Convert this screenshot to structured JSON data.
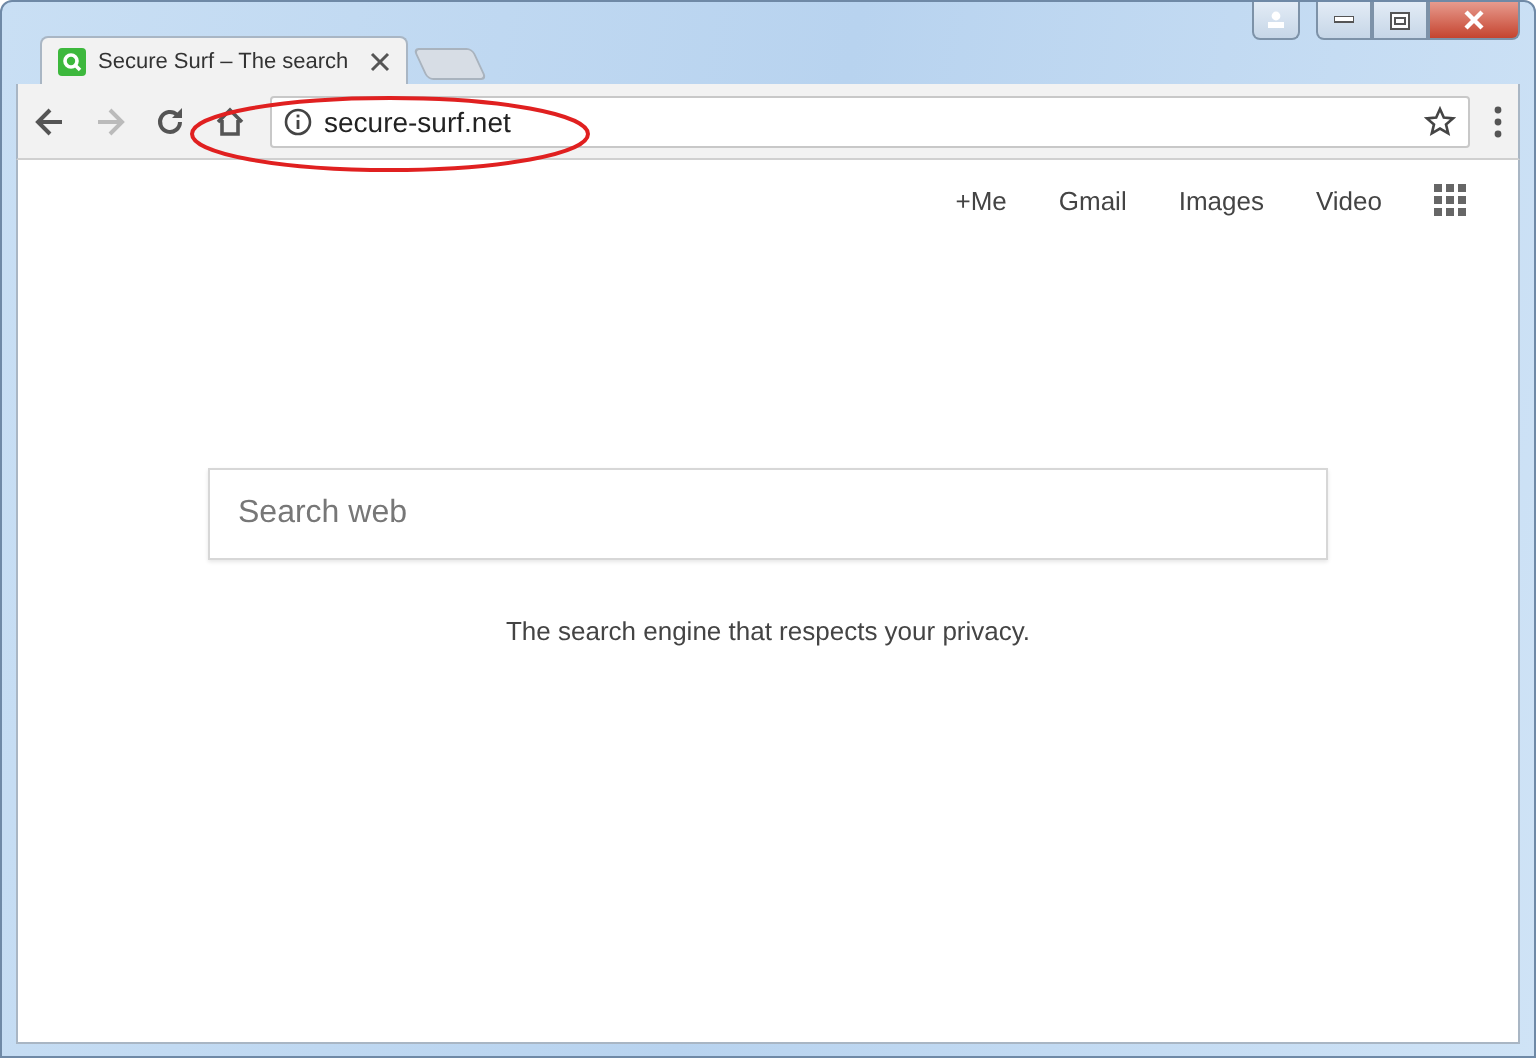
{
  "tab": {
    "title": "Secure Surf – The search",
    "selected": true
  },
  "address_bar": {
    "url": "secure-surf.net"
  },
  "top_links": [
    "+Me",
    "Gmail",
    "Images",
    "Video"
  ],
  "search": {
    "placeholder": "Search web"
  },
  "tagline": "The search engine that respects your privacy."
}
